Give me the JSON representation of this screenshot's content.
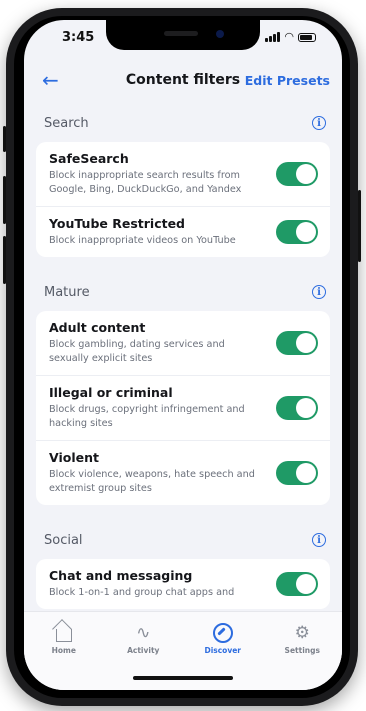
{
  "status": {
    "time": "3:45"
  },
  "nav": {
    "back_label": "←",
    "title": "Content filters",
    "edit_label": "Edit Presets"
  },
  "sections": [
    {
      "label": "Search",
      "items": [
        {
          "title": "SafeSearch",
          "desc": "Block inappropriate search results from Google, Bing, DuckDuckGo, and Yandex",
          "enabled": true
        },
        {
          "title": "YouTube Restricted",
          "desc": "Block inappropriate videos on YouTube",
          "enabled": true
        }
      ]
    },
    {
      "label": "Mature",
      "items": [
        {
          "title": "Adult content",
          "desc": "Block gambling, dating services and sexually explicit sites",
          "enabled": true
        },
        {
          "title": "Illegal or criminal",
          "desc": "Block drugs, copyright infringement and hacking sites",
          "enabled": true
        },
        {
          "title": "Violent",
          "desc": "Block violence, weapons, hate speech and extremist group sites",
          "enabled": true
        }
      ]
    },
    {
      "label": "Social",
      "items": [
        {
          "title": "Chat and messaging",
          "desc": "Block 1-on-1 and group chat apps and",
          "enabled": true
        }
      ]
    }
  ],
  "tabs": [
    {
      "label": "Home",
      "icon": "home-icon",
      "active": false
    },
    {
      "label": "Activity",
      "icon": "activity-pulse-icon",
      "active": false
    },
    {
      "label": "Discover",
      "icon": "compass-icon",
      "active": true
    },
    {
      "label": "Settings",
      "icon": "gear-icon",
      "active": false
    }
  ],
  "colors": {
    "accent": "#2d6cdf",
    "toggle_on": "#1f9a66",
    "background": "#f2f3f8"
  }
}
